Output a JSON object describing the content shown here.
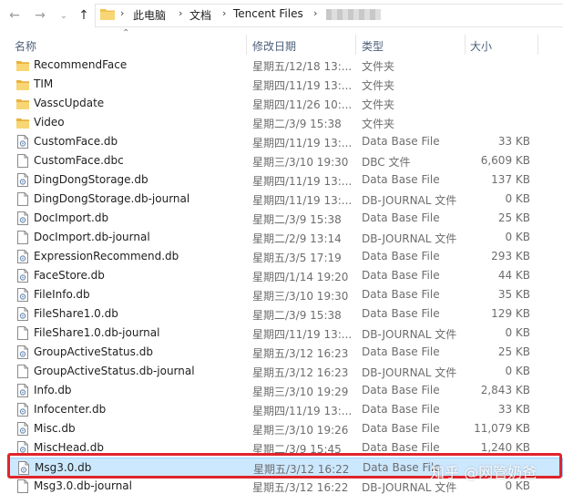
{
  "address": {
    "crumbs": [
      "此电脑",
      "文档",
      "Tencent Files"
    ]
  },
  "columns": {
    "name": "名称",
    "date": "修改日期",
    "type": "类型",
    "size": "大小"
  },
  "rows": [
    {
      "icon": "folder",
      "name": "RecommendFace",
      "date": "星期五/12/18 13:...",
      "type": "文件夹",
      "size": ""
    },
    {
      "icon": "folder",
      "name": "TIM",
      "date": "星期四/11/19 13:...",
      "type": "文件夹",
      "size": ""
    },
    {
      "icon": "folder",
      "name": "VasscUpdate",
      "date": "星期四/11/26 10:...",
      "type": "文件夹",
      "size": ""
    },
    {
      "icon": "folder",
      "name": "Video",
      "date": "星期二/3/9 15:38",
      "type": "文件夹",
      "size": ""
    },
    {
      "icon": "db",
      "name": "CustomFace.db",
      "date": "星期四/11/19 13:...",
      "type": "Data Base File",
      "size": "33 KB"
    },
    {
      "icon": "file",
      "name": "CustomFace.dbc",
      "date": "星期三/3/10 19:30",
      "type": "DBC 文件",
      "size": "6,609 KB"
    },
    {
      "icon": "db",
      "name": "DingDongStorage.db",
      "date": "星期四/11/19 13:...",
      "type": "Data Base File",
      "size": "137 KB"
    },
    {
      "icon": "file",
      "name": "DingDongStorage.db-journal",
      "date": "星期四/11/19 13:...",
      "type": "DB-JOURNAL 文件",
      "size": "0 KB"
    },
    {
      "icon": "db",
      "name": "DocImport.db",
      "date": "星期二/3/9 15:38",
      "type": "Data Base File",
      "size": "25 KB"
    },
    {
      "icon": "file",
      "name": "DocImport.db-journal",
      "date": "星期二/2/9 13:14",
      "type": "DB-JOURNAL 文件",
      "size": "0 KB"
    },
    {
      "icon": "db",
      "name": "ExpressionRecommend.db",
      "date": "星期五/3/5 17:19",
      "type": "Data Base File",
      "size": "293 KB"
    },
    {
      "icon": "db",
      "name": "FaceStore.db",
      "date": "星期四/1/14 19:20",
      "type": "Data Base File",
      "size": "44 KB"
    },
    {
      "icon": "db",
      "name": "FileInfo.db",
      "date": "星期三/3/10 19:30",
      "type": "Data Base File",
      "size": "35 KB"
    },
    {
      "icon": "db",
      "name": "FileShare1.0.db",
      "date": "星期二/3/9 15:38",
      "type": "Data Base File",
      "size": "129 KB"
    },
    {
      "icon": "file",
      "name": "FileShare1.0.db-journal",
      "date": "星期四/11/19 13:...",
      "type": "DB-JOURNAL 文件",
      "size": "0 KB"
    },
    {
      "icon": "db",
      "name": "GroupActiveStatus.db",
      "date": "星期五/3/12 16:23",
      "type": "Data Base File",
      "size": "25 KB"
    },
    {
      "icon": "file",
      "name": "GroupActiveStatus.db-journal",
      "date": "星期五/3/12 16:23",
      "type": "DB-JOURNAL 文件",
      "size": "0 KB"
    },
    {
      "icon": "db",
      "name": "Info.db",
      "date": "星期三/3/10 19:29",
      "type": "Data Base File",
      "size": "2,843 KB"
    },
    {
      "icon": "db",
      "name": "Infocenter.db",
      "date": "星期四/11/19 13:...",
      "type": "Data Base File",
      "size": "33 KB"
    },
    {
      "icon": "db",
      "name": "Misc.db",
      "date": "星期三/3/10 19:26",
      "type": "Data Base File",
      "size": "11,079 KB"
    },
    {
      "icon": "db",
      "name": "MiscHead.db",
      "date": "星期二/3/9 15:45",
      "type": "Data Base File",
      "size": "1,240 KB"
    },
    {
      "icon": "db",
      "name": "Msg3.0.db",
      "date": "星期五/3/12 16:22",
      "type": "Data Base File",
      "size": "",
      "selected": true
    },
    {
      "icon": "file",
      "name": "Msg3.0.db-journal",
      "date": "星期五/3/12 16:22",
      "type": "DB-JOURNAL 文件",
      "size": "0 KB"
    }
  ],
  "watermark": "知乎 @网管奶爸",
  "colors": {
    "selection": "#cce8ff",
    "highlight_box": "#e0242c",
    "folder": "#f2c14e"
  }
}
